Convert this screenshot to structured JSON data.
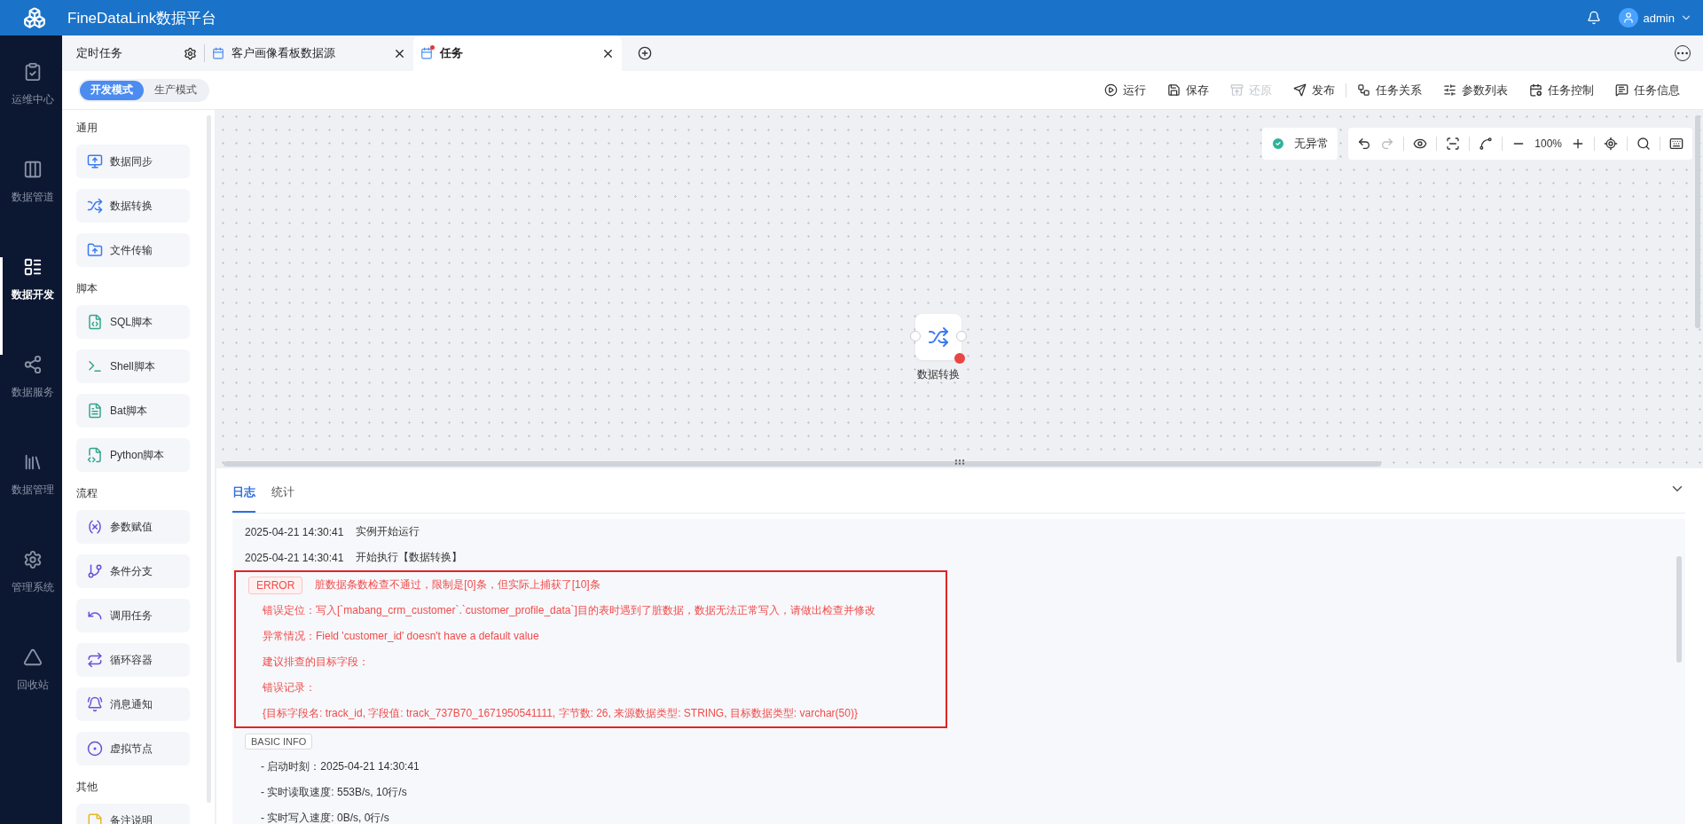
{
  "app": {
    "title": "FineDataLink数据平台",
    "user": "admin"
  },
  "nav": [
    {
      "label": "运维中心",
      "selected": false
    },
    {
      "label": "数据管道",
      "selected": false
    },
    {
      "label": "数据开发",
      "selected": true
    },
    {
      "label": "数据服务",
      "selected": false
    },
    {
      "label": "数据管理",
      "selected": false
    },
    {
      "label": "管理系统",
      "selected": false
    },
    {
      "label": "回收站",
      "selected": false
    }
  ],
  "tabs": [
    {
      "label": "定时任务",
      "kind": "folder",
      "selected": false
    },
    {
      "label": "客户画像看板数据源",
      "kind": "task",
      "selected": false,
      "modified": false
    },
    {
      "label": "任务",
      "kind": "task",
      "selected": true,
      "modified": true
    }
  ],
  "modes": [
    {
      "label": "开发模式",
      "selected": true
    },
    {
      "label": "生产模式",
      "selected": false
    }
  ],
  "actions": [
    {
      "label": "运行",
      "disabled": false
    },
    {
      "label": "保存",
      "disabled": false
    },
    {
      "label": "还原",
      "disabled": true
    },
    {
      "label": "发布",
      "disabled": false
    },
    {
      "label": "任务关系",
      "disabled": false
    },
    {
      "label": "参数列表",
      "disabled": false
    },
    {
      "label": "任务控制",
      "disabled": false
    },
    {
      "label": "任务信息",
      "disabled": false
    }
  ],
  "palette": [
    {
      "group": "通用",
      "items": [
        "数据同步",
        "数据转换",
        "文件传输"
      ]
    },
    {
      "group": "脚本",
      "items": [
        "SQL脚本",
        "Shell脚本",
        "Bat脚本",
        "Python脚本"
      ]
    },
    {
      "group": "流程",
      "items": [
        "参数赋值",
        "条件分支",
        "调用任务",
        "循环容器",
        "消息通知",
        "虚拟节点"
      ]
    },
    {
      "group": "其他",
      "items": [
        "备注说明"
      ]
    }
  ],
  "canvas": {
    "status": "无异常",
    "zoom": "100%",
    "node": {
      "label": "数据转换",
      "error": true
    }
  },
  "log": {
    "tabs": [
      {
        "label": "日志",
        "selected": true
      },
      {
        "label": "统计",
        "selected": false
      }
    ],
    "lines": [
      {
        "kind": "event",
        "time": "2025-04-21 14:30:41",
        "text": "实例开始运行"
      },
      {
        "kind": "event",
        "time": "2025-04-21 14:30:41",
        "text": "开始执行【数据转换】"
      },
      {
        "kind": "error",
        "tag": "ERROR",
        "message": "脏数据条数检查不通过，限制是[0]条，但实际上捕获了[10]条",
        "details": [
          "错误定位：写入[`mabang_crm_customer`.`customer_profile_data`]目的表时遇到了脏数据，数据无法正常写入，请做出检查并修改",
          "异常情况：Field 'customer_id' doesn't have a default value",
          "建议排查的目标字段：",
          "错误记录：",
          "{目标字段名: track_id, 字段值: track_737B70_1671950541111, 字节数: 26, 来源数据类型: STRING, 目标数据类型: varchar(50)}"
        ]
      },
      {
        "kind": "section",
        "tag": "BASIC INFO",
        "details": [
          "- 启动时刻：2025-04-21 14:30:41",
          "- 实时读取速度: 553B/s, 10行/s",
          "- 实时写入速度: 0B/s, 0行/s"
        ]
      }
    ]
  }
}
